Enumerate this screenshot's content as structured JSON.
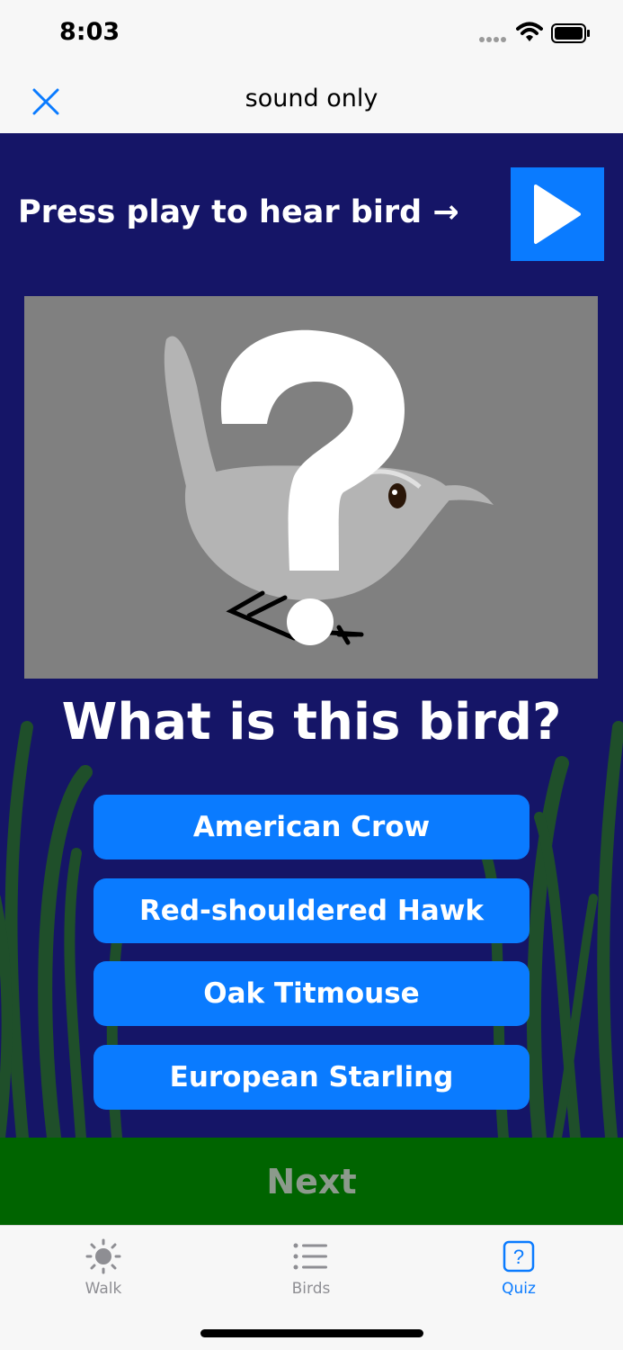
{
  "status": {
    "time": "8:03"
  },
  "nav": {
    "title": "sound only",
    "close_icon": "close-x-icon"
  },
  "prompt": {
    "text": "Press play to hear bird →",
    "play_icon": "play-triangle-icon"
  },
  "question": "What is this bird?",
  "answers": [
    "American Crow",
    "Red-shouldered Hawk",
    "Oak Titmouse",
    "European Starling"
  ],
  "next_label": "Next",
  "tabs": [
    {
      "label": "Walk",
      "icon": "sun-icon",
      "active": false
    },
    {
      "label": "Birds",
      "icon": "list-icon",
      "active": false
    },
    {
      "label": "Quiz",
      "icon": "question-square-icon",
      "active": true
    }
  ],
  "colors": {
    "main_bg": "#151567",
    "accent": "#0a7bff",
    "next_bar": "#006400",
    "grass": "#1f4f2a",
    "active_tab": "#0a7bff",
    "inactive_tab": "#8e8e93"
  }
}
